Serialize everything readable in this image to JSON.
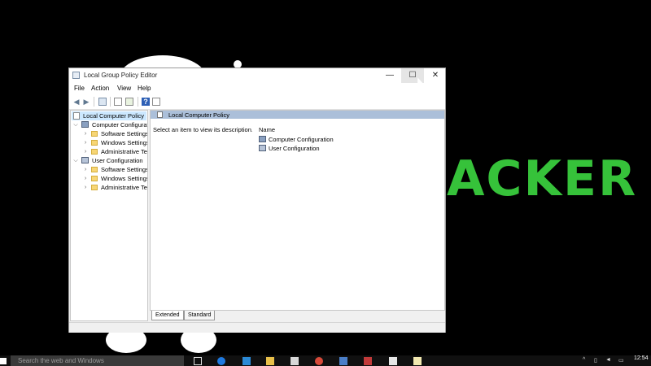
{
  "window": {
    "title": "Local Group Policy Editor",
    "controls": {
      "minimize": "—",
      "maximize": "☐",
      "close": "✕"
    }
  },
  "menu": [
    "File",
    "Action",
    "View",
    "Help"
  ],
  "toolbar": [
    "back-arrow-icon",
    "forward-arrow-icon",
    "show-hide-tree-icon",
    "properties-icon",
    "export-list-icon",
    "help-icon",
    "extended-view-icon"
  ],
  "tree": {
    "root": "Local Computer Policy",
    "items": [
      {
        "label": "Computer Configuration",
        "icon": "computer-icon",
        "twisty": "⌵"
      },
      {
        "label": "Software Settings",
        "icon": "folder-icon",
        "twisty": "›"
      },
      {
        "label": "Windows Settings",
        "icon": "folder-icon",
        "twisty": "›"
      },
      {
        "label": "Administrative Templates",
        "icon": "folder-icon",
        "twisty": "›"
      },
      {
        "label": "User Configuration",
        "icon": "user-icon",
        "twisty": "⌵"
      },
      {
        "label": "Software Settings",
        "icon": "folder-icon",
        "twisty": "›"
      },
      {
        "label": "Windows Settings",
        "icon": "folder-icon",
        "twisty": "›"
      },
      {
        "label": "Administrative Templates",
        "icon": "folder-icon",
        "twisty": "›"
      }
    ]
  },
  "details": {
    "header": "Local Computer Policy",
    "description": "Select an item to view its description.",
    "column": "Name",
    "rows": [
      "Computer Configuration",
      "User Configuration"
    ]
  },
  "tabs": [
    "Extended",
    "Standard"
  ],
  "taskbar": {
    "search_placeholder": "Search the web and Windows",
    "clock": "12:54"
  },
  "wallpaper_text": "ACKER",
  "colors": {
    "header_band": "#abbfd9",
    "wallpaper_text": "#36c23a",
    "selection": "#cce8ff"
  }
}
